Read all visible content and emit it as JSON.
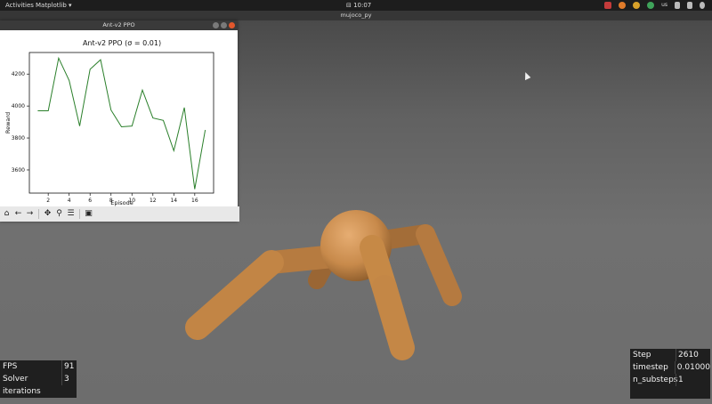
{
  "topbar": {
    "activities": "Activities",
    "app_menu": "Matplotlib ▾",
    "clock": "⊟ 10:07",
    "keyboard": "us"
  },
  "mujoco": {
    "title": "mujoco_py"
  },
  "plot_window": {
    "title": "Ant-v2 PPO",
    "toolbar": [
      "home-icon",
      "back-icon",
      "forward-icon",
      "pan-icon",
      "zoom-icon",
      "configure-icon",
      "save-icon"
    ]
  },
  "chart_data": {
    "type": "line",
    "title": "Ant-v2 PPO (σ = 0.01)",
    "xlabel": "Episode",
    "ylabel": "Reward",
    "x": [
      1,
      2,
      3,
      4,
      5,
      6,
      7,
      8,
      9,
      10,
      11,
      12,
      13,
      14,
      15,
      16,
      17
    ],
    "series": [
      {
        "color": "#2a7f2a",
        "values": [
          3970,
          3970,
          4300,
          4160,
          3875,
          4230,
          4290,
          3975,
          3870,
          3875,
          4100,
          3925,
          3910,
          3720,
          3990,
          3480,
          3850
        ]
      }
    ],
    "xticks": [
      2,
      4,
      6,
      8,
      10,
      12,
      14,
      16
    ],
    "yticks": [
      3600,
      3800,
      4000,
      4200
    ],
    "xlim": [
      0.2,
      17.8
    ],
    "ylim": [
      3455,
      4335
    ],
    "grid": false
  },
  "stats_left": {
    "rows": [
      {
        "label": "FPS",
        "value": "91"
      },
      {
        "label": "Solver iterations",
        "value": "3"
      }
    ]
  },
  "stats_right": {
    "rows": [
      {
        "label": "Step",
        "value": "2610"
      },
      {
        "label": "timestep",
        "value": "0.01000"
      },
      {
        "label": "n_substeps",
        "value": "1"
      }
    ]
  }
}
